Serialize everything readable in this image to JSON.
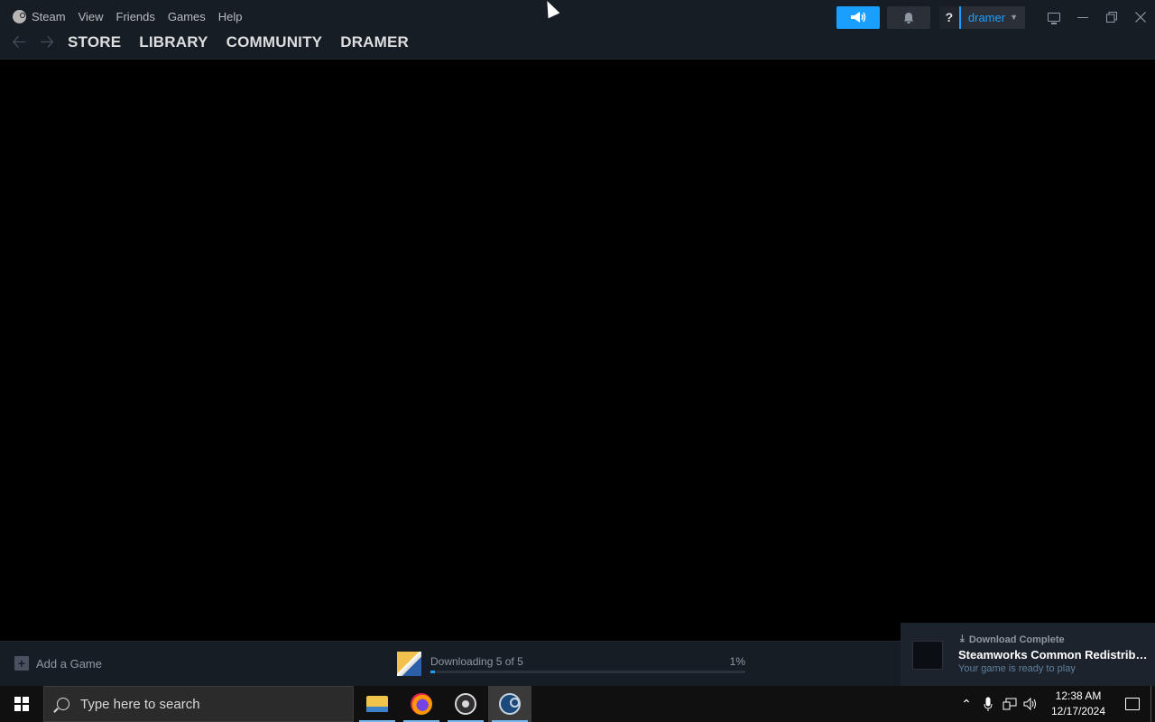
{
  "menu": {
    "steam": "Steam",
    "view": "View",
    "friends": "Friends",
    "games": "Games",
    "help": "Help"
  },
  "nav": {
    "store": "STORE",
    "library": "LIBRARY",
    "community": "COMMUNITY",
    "profile": "DRAMER"
  },
  "header": {
    "help_label": "?",
    "username": "dramer"
  },
  "bottom": {
    "add_game": "Add a Game",
    "download_label": "Downloading 5 of 5",
    "download_percent": "1%",
    "download_progress_fraction": 0.01
  },
  "toast": {
    "heading": "Download Complete",
    "title": "Steamworks Common Redistributables",
    "subtitle": "Your game is ready to play"
  },
  "taskbar": {
    "search_placeholder": "Type here to search",
    "time": "12:38 AM",
    "date": "12/17/2024"
  },
  "colors": {
    "accent": "#1a9fff",
    "header_bg": "#171d25",
    "body_bg": "#000000",
    "taskbar_bg": "#101010"
  },
  "icons": [
    "steam-logo-icon",
    "back-arrow-icon",
    "forward-arrow-icon",
    "megaphone-icon",
    "bell-icon",
    "monitor-icon",
    "minimize-icon",
    "restore-icon",
    "close-icon",
    "plus-icon",
    "download-icon",
    "windows-logo-icon",
    "search-icon",
    "file-explorer-icon",
    "firefox-icon",
    "obs-icon",
    "steam-taskbar-icon",
    "chevron-up-icon",
    "microphone-icon",
    "network-icon",
    "volume-icon",
    "action-center-icon"
  ]
}
